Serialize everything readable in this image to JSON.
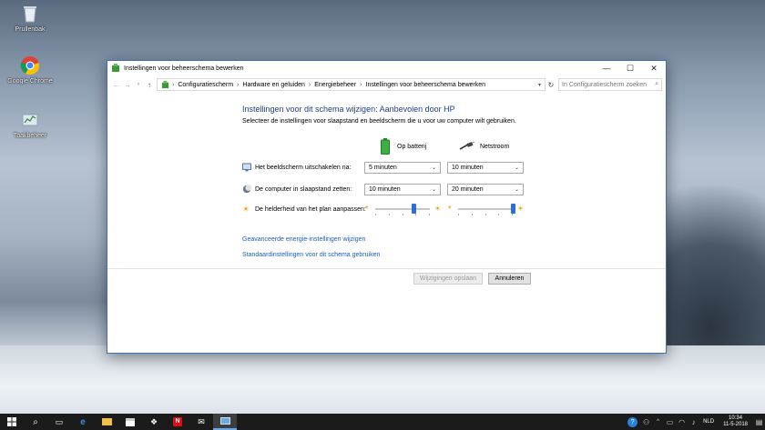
{
  "desktop": {
    "icons": [
      {
        "label": "Prullenbak"
      },
      {
        "label": "Google Chrome"
      },
      {
        "label": "Taakbeheer"
      }
    ]
  },
  "window": {
    "title": "Instellingen voor beheerschema bewerken",
    "controls": {
      "minimize": "—",
      "maximize": "☐",
      "close": "✕"
    }
  },
  "address": {
    "crumbs": [
      "Configuratiescherm",
      "Hardware en geluiden",
      "Energiebeheer",
      "Instellingen voor beheerschema bewerken"
    ],
    "search_placeholder": "In Configuratiescherm zoeken"
  },
  "main": {
    "heading": "Instellingen voor dit schema wijzigen: Aanbevolen door HP",
    "subheading": "Selecteer de instellingen voor slaapstand en beeldscherm die u voor uw computer wilt gebruiken.",
    "col_battery": "Op batterij",
    "col_power": "Netstroom",
    "rows": {
      "display_label": "Het beeldscherm uitschakelen na:",
      "display_battery": "5 minuten",
      "display_power": "10 minuten",
      "sleep_label": "De computer in slaapstand zetten:",
      "sleep_battery": "10 minuten",
      "sleep_power": "20 minuten",
      "brightness_label": "De helderheid van het plan aanpassen:",
      "brightness_battery_pct": 70,
      "brightness_power_pct": 100
    },
    "link_advanced": "Geavanceerde energie-instellingen wijzigen",
    "link_defaults": "Standaardinstellingen voor dit schema gebruiken",
    "save_button": "Wijzigingen opslaan",
    "cancel_button": "Annuleren"
  },
  "taskbar": {
    "tray_lang": "NLD",
    "time": "10:34",
    "date": "11-5-2018"
  },
  "colors": {
    "heading": "#1e3f8a",
    "link": "#1a5ec1",
    "slider_thumb": "#2a6fd6",
    "window_border": "#3a70b8"
  }
}
